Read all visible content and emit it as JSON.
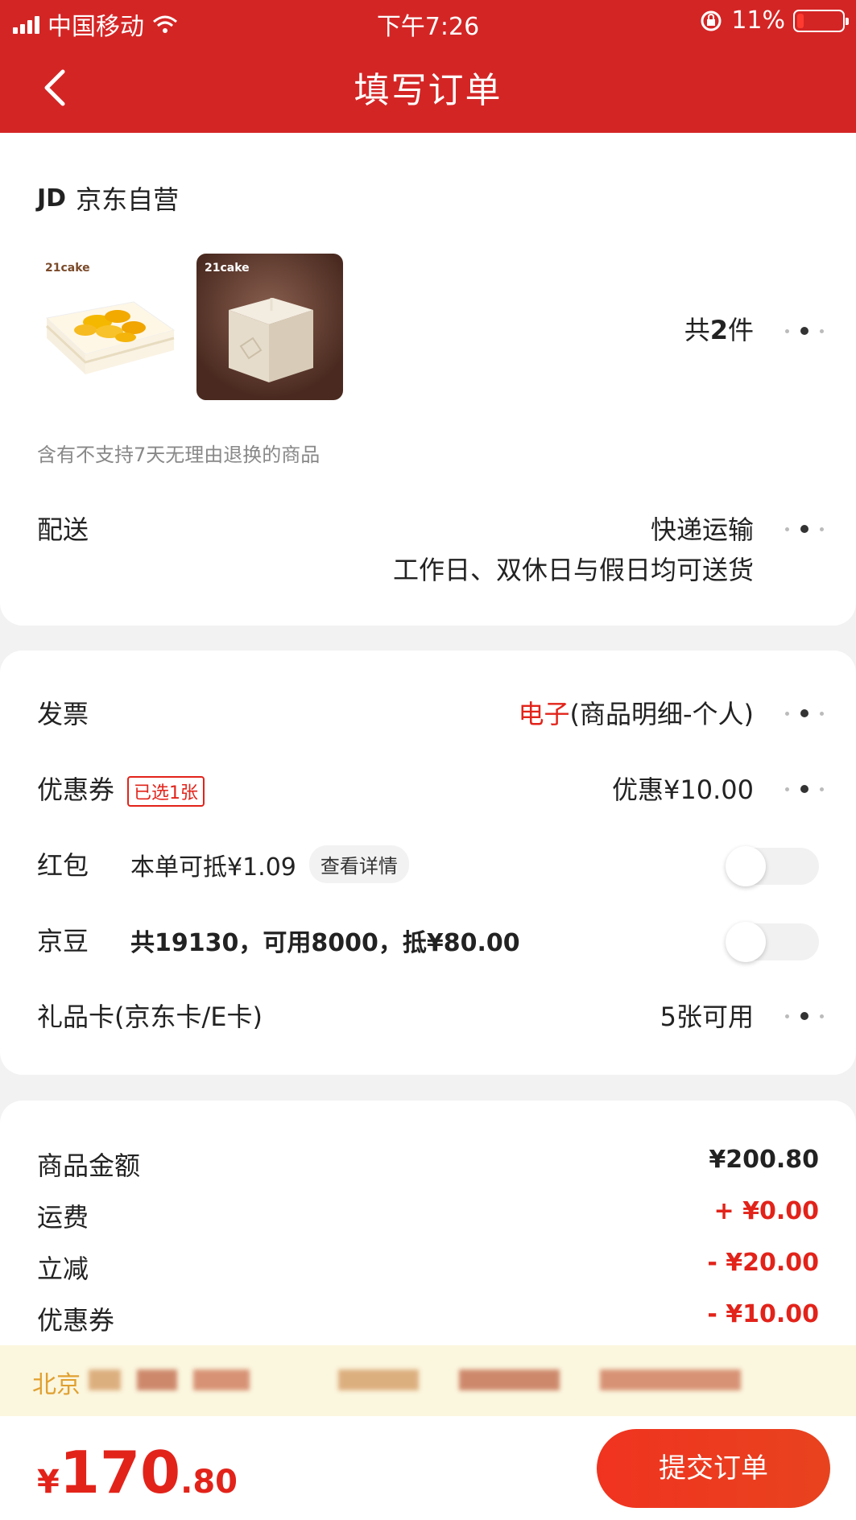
{
  "status_bar": {
    "carrier": "中国移动",
    "time": "下午7:26",
    "battery": "11%"
  },
  "nav": {
    "title": "填写订单"
  },
  "shop": {
    "logo": "JD",
    "name": "京东自营"
  },
  "products": {
    "thumb_brands": [
      "21cake",
      "21cake"
    ],
    "count_prefix": "共",
    "count": "2",
    "count_suffix": "件",
    "return_note": "含有不支持7天无理由退换的商品"
  },
  "delivery": {
    "label": "配送",
    "method": "快递运输",
    "detail": "工作日、双休日与假日均可送货"
  },
  "invoice": {
    "label": "发票",
    "type": "电子",
    "detail": "(商品明细-个人)"
  },
  "coupon": {
    "label": "优惠券",
    "badge": "已选1张",
    "value": "优惠¥10.00"
  },
  "red_packet": {
    "label": "红包",
    "text": "本单可抵¥1.09",
    "detail_button": "查看详情",
    "enabled": false
  },
  "jingdou": {
    "label": "京豆",
    "text": "共19130，可用8000，抵¥80.00",
    "enabled": false
  },
  "gift_card": {
    "label": "礼品卡(京东卡/E卡)",
    "value": "5张可用"
  },
  "amounts": [
    {
      "label": "商品金额",
      "value": "¥200.80",
      "color": "#222222"
    },
    {
      "label": "运费",
      "value": "+ ¥0.00",
      "color": "#e2231a"
    },
    {
      "label": "立减",
      "value": "- ¥20.00",
      "color": "#e2231a"
    },
    {
      "label": "优惠券",
      "value": "- ¥10.00",
      "color": "#e2231a"
    }
  ],
  "address": {
    "text": "北京"
  },
  "footer": {
    "currency": "¥",
    "total_int": "170",
    "total_dec": ".80",
    "submit_label": "提交订单"
  },
  "colors": {
    "brand_red": "#d42525",
    "accent_red": "#e2231a"
  }
}
